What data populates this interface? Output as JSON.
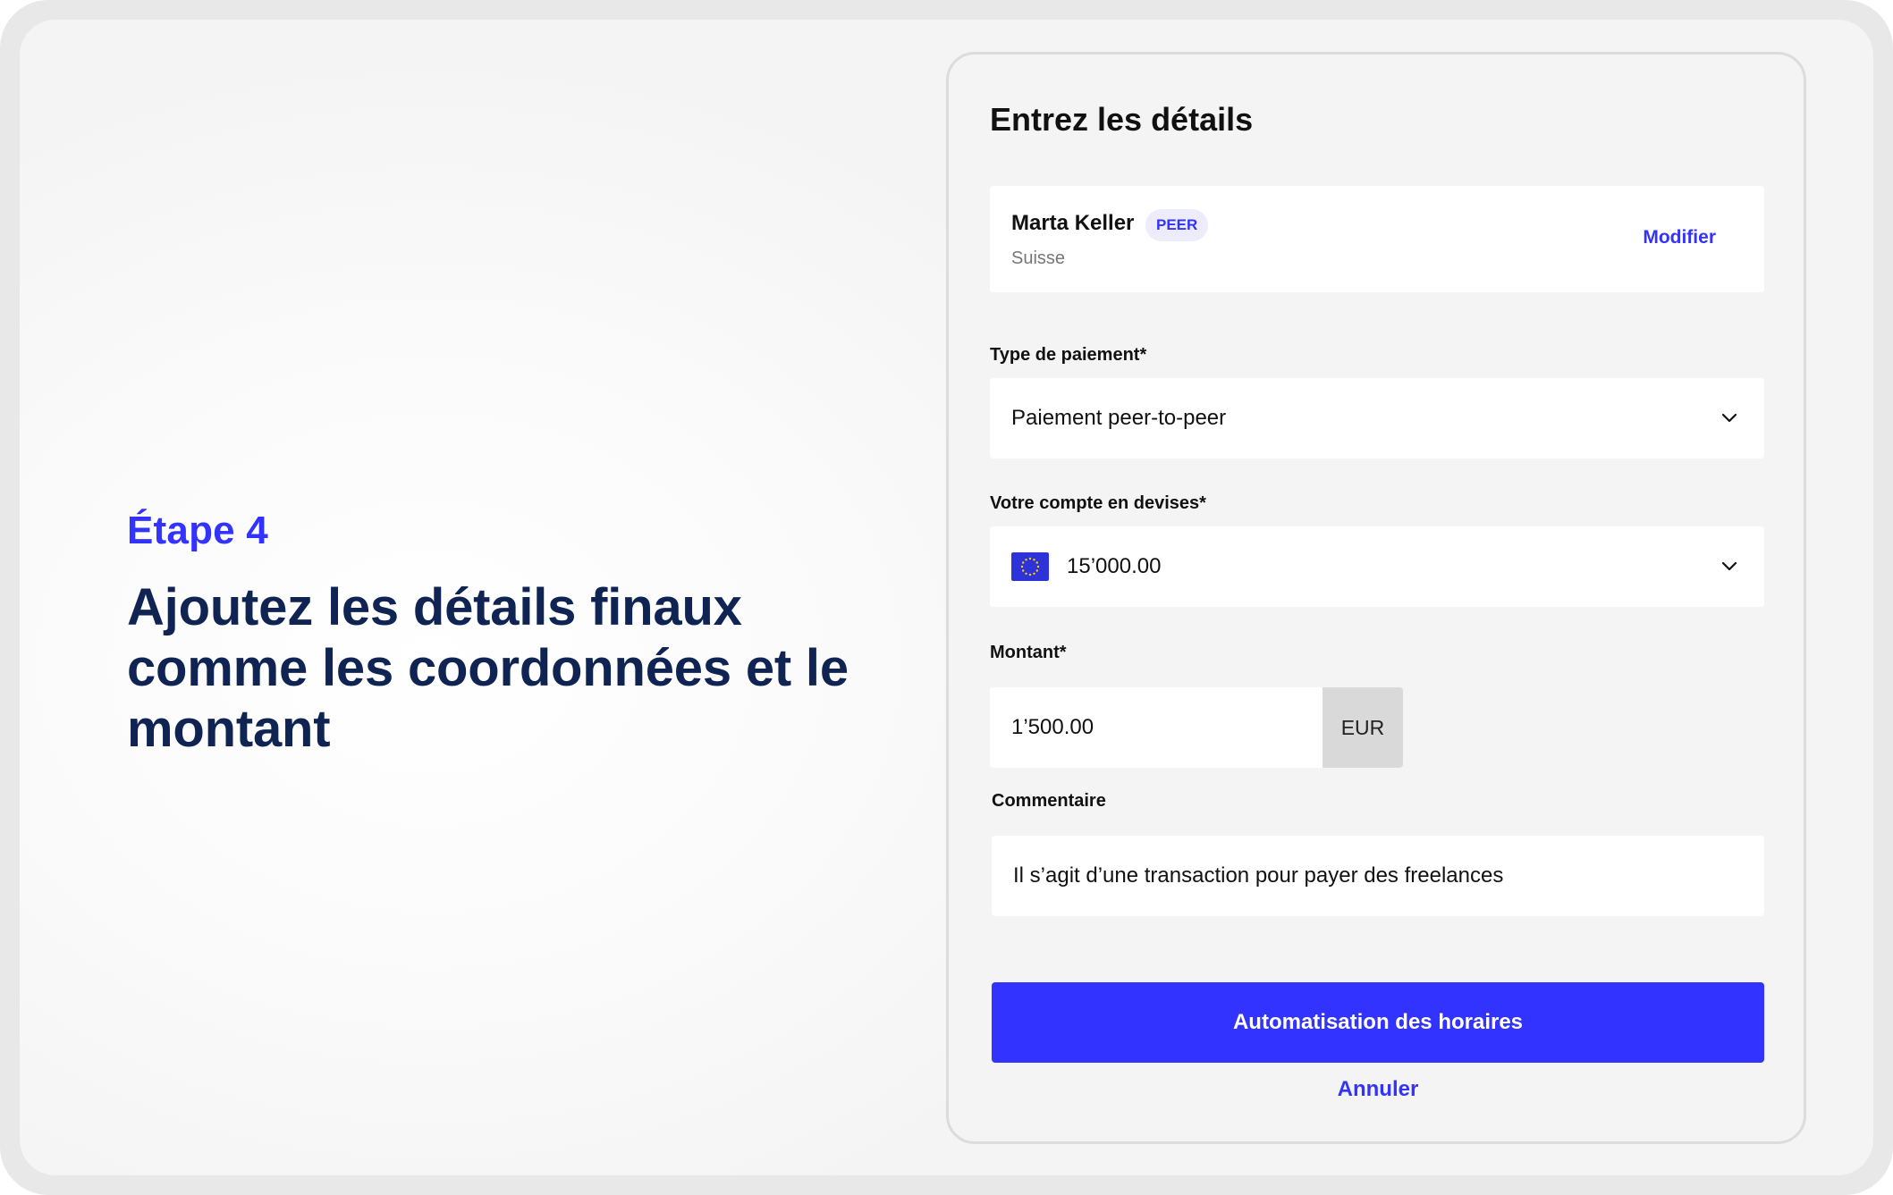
{
  "colors": {
    "accent": "#3333ff",
    "heading_navy": "#0f2452",
    "eu_blue": "#2d33d9",
    "eu_star": "#ffd200"
  },
  "intro": {
    "step_label": "Étape 4",
    "headline": "Ajoutez les détails finaux comme les coordonnées et le montant"
  },
  "form": {
    "title": "Entrez les détails",
    "recipient": {
      "name": "Marta Keller",
      "badge": "PEER",
      "country": "Suisse",
      "edit_label": "Modifier"
    },
    "payment_type": {
      "label": "Type de paiement*",
      "value": "Paiement peer-to-peer",
      "icon": "chevron-down-icon"
    },
    "currency_account": {
      "label": "Votre compte en devises*",
      "value": "15’000.00",
      "flag_icon": "eu-flag-icon",
      "icon": "chevron-down-icon"
    },
    "amount": {
      "label": "Montant*",
      "value": "1’500.00",
      "currency": "EUR"
    },
    "comment": {
      "label": "Commentaire",
      "value": "Il s’agit d’une transaction pour payer des freelances"
    },
    "submit_label": "Automatisation des horaires",
    "cancel_label": "Annuler"
  }
}
